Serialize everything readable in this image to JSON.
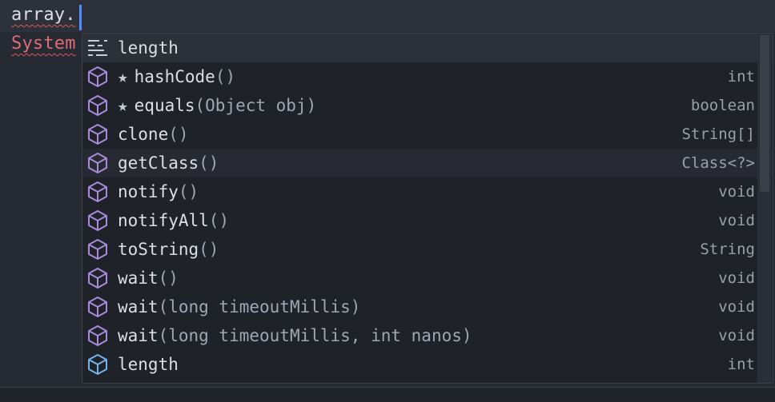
{
  "editor": {
    "line1": "array.",
    "line2": "System"
  },
  "colors": {
    "method_icon": "#a98bd9",
    "field_icon": "#74b4ea",
    "error_squiggle": "#d75a5a",
    "cursor": "#4f8ff7"
  },
  "completion": {
    "items": [
      {
        "kind": "snippet",
        "name": "length",
        "params": "",
        "type": ""
      },
      {
        "kind": "method",
        "starred": true,
        "name": "hashCode",
        "params": "()",
        "type": "int"
      },
      {
        "kind": "method",
        "starred": true,
        "name": "equals",
        "params": "(Object obj)",
        "type": "boolean"
      },
      {
        "kind": "method",
        "name": "clone",
        "params": "()",
        "type": "String[]"
      },
      {
        "kind": "method",
        "name": "getClass",
        "params": "()",
        "type": "Class<?>"
      },
      {
        "kind": "method",
        "name": "notify",
        "params": "()",
        "type": "void"
      },
      {
        "kind": "method",
        "name": "notifyAll",
        "params": "()",
        "type": "void"
      },
      {
        "kind": "method",
        "name": "toString",
        "params": "()",
        "type": "String"
      },
      {
        "kind": "method",
        "name": "wait",
        "params": "()",
        "type": "void"
      },
      {
        "kind": "method",
        "name": "wait",
        "params": "(long timeoutMillis)",
        "type": "void"
      },
      {
        "kind": "method",
        "name": "wait",
        "params": "(long timeoutMillis, int nanos)",
        "type": "void"
      },
      {
        "kind": "field",
        "name": "length",
        "params": "",
        "type": "int"
      }
    ]
  }
}
